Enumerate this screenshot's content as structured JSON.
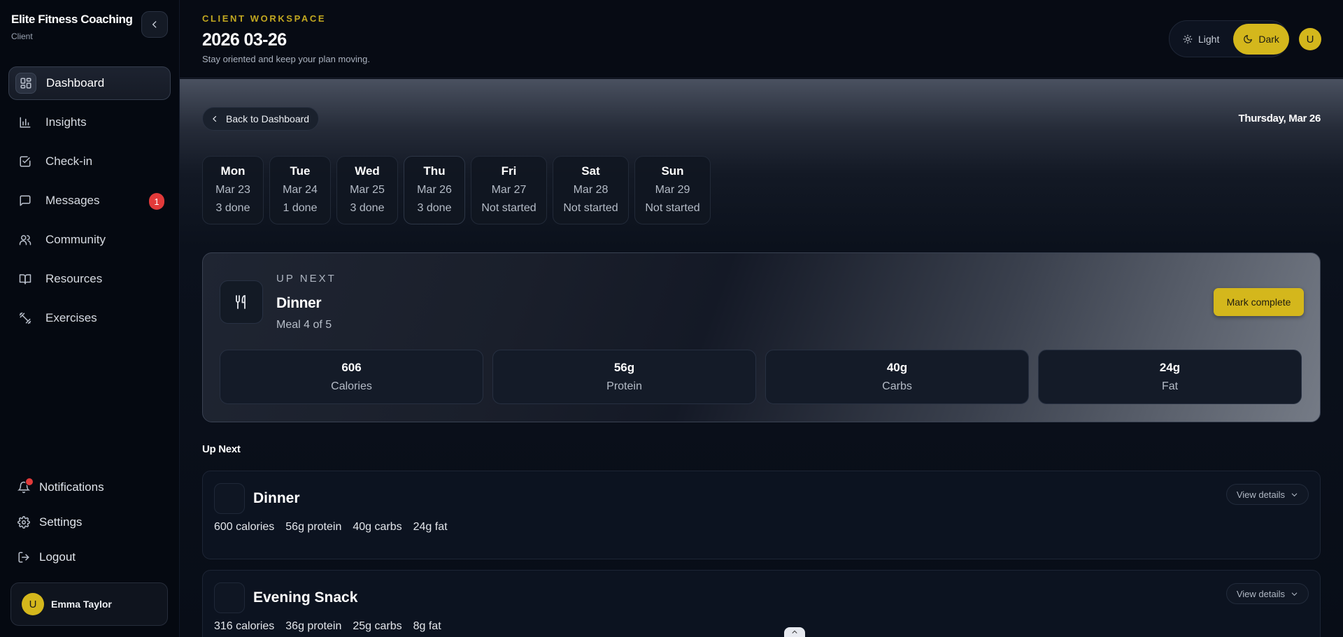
{
  "brand": {
    "name": "Elite Fitness Coaching",
    "role": "Client"
  },
  "sidebar": {
    "items": [
      {
        "label": "Dashboard",
        "icon": "dashboard-icon",
        "active": true
      },
      {
        "label": "Insights",
        "icon": "bar-chart-icon"
      },
      {
        "label": "Check-in",
        "icon": "check-square-icon"
      },
      {
        "label": "Messages",
        "icon": "message-icon",
        "badge": "1"
      },
      {
        "label": "Community",
        "icon": "users-icon"
      },
      {
        "label": "Resources",
        "icon": "book-icon"
      },
      {
        "label": "Exercises",
        "icon": "dumbbell-icon"
      }
    ],
    "bottom": {
      "notifications": "Notifications",
      "settings": "Settings",
      "logout": "Logout"
    },
    "user": {
      "initial": "U",
      "name": "Emma Taylor"
    }
  },
  "header": {
    "eyebrow": "CLIENT WORKSPACE",
    "title": "2026 03-26",
    "subtitle": "Stay oriented and keep your plan moving.",
    "theme": {
      "light": "Light",
      "dark": "Dark",
      "selected": "dark"
    },
    "avatar": "U"
  },
  "main": {
    "back_label": "Back to Dashboard",
    "date_label": "Thursday, Mar 26",
    "days": [
      {
        "name": "Mon",
        "date": "Mar 23",
        "status": "3 done"
      },
      {
        "name": "Tue",
        "date": "Mar 24",
        "status": "1 done"
      },
      {
        "name": "Wed",
        "date": "Mar 25",
        "status": "3 done"
      },
      {
        "name": "Thu",
        "date": "Mar 26",
        "status": "3 done"
      },
      {
        "name": "Fri",
        "date": "Mar 27",
        "status": "Not started"
      },
      {
        "name": "Sat",
        "date": "Mar 28",
        "status": "Not started"
      },
      {
        "name": "Sun",
        "date": "Mar 29",
        "status": "Not started"
      }
    ],
    "hero": {
      "eyebrow": "UP NEXT",
      "title": "Dinner",
      "subtitle": "Meal 4 of 5",
      "button": "Mark complete",
      "macros": [
        {
          "value": "606",
          "label": "Calories"
        },
        {
          "value": "56g",
          "label": "Protein"
        },
        {
          "value": "40g",
          "label": "Carbs"
        },
        {
          "value": "24g",
          "label": "Fat"
        }
      ]
    },
    "section_label": "Up Next",
    "meals": [
      {
        "title": "Dinner",
        "stats": [
          "600 calories",
          "56g protein",
          "40g carbs",
          "24g fat"
        ],
        "details": "View details"
      },
      {
        "title": "Evening Snack",
        "stats": [
          "316 calories",
          "36g protein",
          "25g carbs",
          "8g fat"
        ],
        "details": "View details"
      }
    ]
  },
  "colors": {
    "accent": "#d4b71c",
    "badge": "#e23a3a",
    "background": "#060a12"
  }
}
